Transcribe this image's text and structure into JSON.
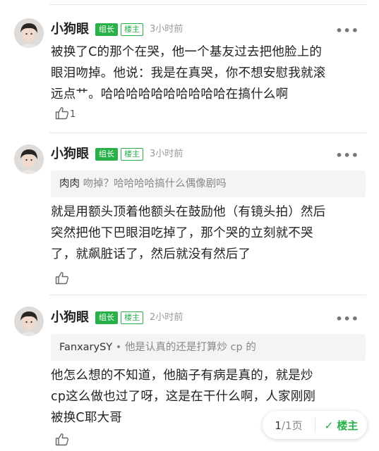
{
  "comments": [
    {
      "username": "小狗眼",
      "badge_admin": "组长",
      "badge_op": "楼主",
      "time": "3小时前",
      "more": "•••",
      "body_lines": [
        "被换了C的那个在哭，他一个基友过去把他脸上的",
        "眼泪吻掉。他说：我是在真哭，你不想安慰我就滚",
        "远点艹。哈哈哈哈哈哈哈哈哈哈在搞什么啊"
      ],
      "like_count": "1"
    },
    {
      "username": "小狗眼",
      "badge_admin": "组长",
      "badge_op": "楼主",
      "time": "3小时前",
      "more": "•••",
      "quote_name": "肉肉",
      "quote_text": "吻掉？哈哈哈哈搞什么偶像剧吗",
      "body_lines": [
        "就是用额头顶着他额头在鼓励他（有镜头拍）然后",
        "突然把他下巴眼泪吃掉了，那个哭的立刻就不哭",
        "了，就飙脏话了，然后就没有然后了"
      ]
    },
    {
      "username": "小狗眼",
      "badge_admin": "组长",
      "badge_op": "楼主",
      "time": "2小时前",
      "more": "•••",
      "quote_name": "FanxarySY",
      "quote_text": "他是认真的还是打算炒 cp 的",
      "body_lines": [
        "他怎么想的不知道，他脑子有病是真的，就是炒",
        "cp这么做也过了呀，这是在干什么啊，人家刚刚",
        "被换C耶大哥"
      ]
    }
  ],
  "pager": {
    "current": "1",
    "total": "/1页",
    "op_check": "✓",
    "op_label": "楼主"
  },
  "icons": [
    "avatar",
    "thumbs-up-icon",
    "more-icon",
    "check-icon"
  ],
  "colors": {
    "accent_green": "#27b148",
    "quote_bg": "#f4f4f4",
    "meta_gray": "#9a9a9a"
  }
}
